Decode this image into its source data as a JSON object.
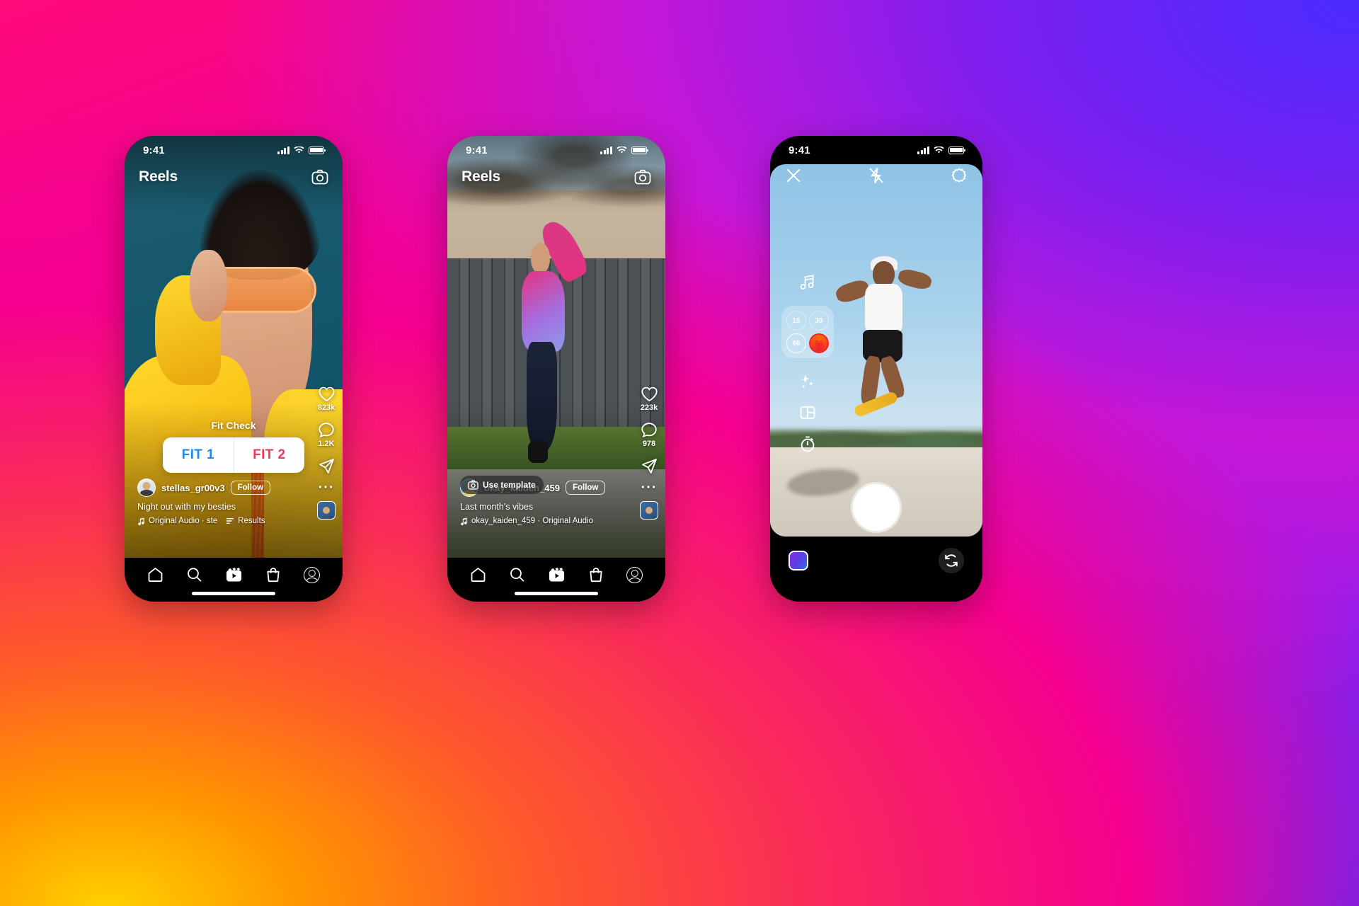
{
  "background": {
    "gradient_colors": [
      "#ff0a7a",
      "#f5008f",
      "#c814cf",
      "#8a1ef0",
      "#5b2bff",
      "#ff9500",
      "#ffd000"
    ]
  },
  "phones": [
    {
      "id": "reels-poll",
      "status_bar": {
        "time": "9:41",
        "signal_icon": "cellular-bars-icon",
        "wifi_icon": "wifi-icon",
        "battery_icon": "battery-icon"
      },
      "header": {
        "title": "Reels",
        "camera_icon": "camera-icon"
      },
      "poll": {
        "question": "Fit Check",
        "option_1": "FIT 1",
        "option_2": "FIT 2",
        "option_1_color": "#1b8ce8",
        "option_2_color": "#ef3b5b"
      },
      "actions": [
        {
          "icon": "heart-icon",
          "count": "823k"
        },
        {
          "icon": "comment-icon",
          "count": "1.2K"
        },
        {
          "icon": "share-icon",
          "count": ""
        },
        {
          "icon": "more-options-icon",
          "count": ""
        },
        {
          "icon": "audio-thumbnail-icon",
          "count": ""
        }
      ],
      "meta": {
        "username": "stellas_gr00v3",
        "follow_label": "Follow",
        "caption": "Night out with my besties",
        "audio_icon": "music-note-icon",
        "audio_label": "Original Audio · ste",
        "results_icon": "results-list-icon",
        "results_label": "Results"
      },
      "nav": [
        {
          "icon": "home-icon",
          "name": "nav-home"
        },
        {
          "icon": "search-icon",
          "name": "nav-search"
        },
        {
          "icon": "reels-icon",
          "name": "nav-reels"
        },
        {
          "icon": "shop-bag-icon",
          "name": "nav-shop"
        },
        {
          "icon": "profile-icon",
          "name": "nav-profile"
        }
      ]
    },
    {
      "id": "reels-template",
      "status_bar": {
        "time": "9:41",
        "signal_icon": "cellular-bars-icon",
        "wifi_icon": "wifi-icon",
        "battery_icon": "battery-icon"
      },
      "header": {
        "title": "Reels",
        "camera_icon": "camera-icon"
      },
      "template_chip": {
        "icon": "camera-icon",
        "label": "Use template"
      },
      "actions": [
        {
          "icon": "heart-icon",
          "count": "223k"
        },
        {
          "icon": "comment-icon",
          "count": "978"
        },
        {
          "icon": "share-icon",
          "count": ""
        },
        {
          "icon": "more-options-icon",
          "count": ""
        },
        {
          "icon": "audio-thumbnail-icon",
          "count": ""
        }
      ],
      "meta": {
        "username": "okay_kaiden_459",
        "follow_label": "Follow",
        "caption": "Last month's vibes",
        "audio_icon": "music-note-icon",
        "audio_label": "okay_kaiden_459 · Original Audio"
      },
      "nav": [
        {
          "icon": "home-icon",
          "name": "nav-home"
        },
        {
          "icon": "search-icon",
          "name": "nav-search"
        },
        {
          "icon": "reels-icon",
          "name": "nav-reels"
        },
        {
          "icon": "shop-bag-icon",
          "name": "nav-shop"
        },
        {
          "icon": "profile-icon",
          "name": "nav-profile"
        }
      ]
    },
    {
      "id": "reels-camera",
      "status_bar": {
        "time": "9:41",
        "signal_icon": "cellular-bars-icon",
        "wifi_icon": "wifi-icon",
        "battery_icon": "battery-icon"
      },
      "top_bar": {
        "close_icon": "close-icon",
        "flash_icon": "flash-off-icon",
        "settings_icon": "settings-gear-icon"
      },
      "tools": [
        {
          "icon": "music-note-icon",
          "name": "add-audio-tool"
        },
        {
          "icon": "effects-sparkle-icon",
          "name": "effects-tool"
        },
        {
          "icon": "layout-grid-icon",
          "name": "layout-tool"
        },
        {
          "icon": "timer-icon",
          "name": "timer-tool"
        }
      ],
      "durations": [
        {
          "value": "15",
          "selected": false
        },
        {
          "value": "30",
          "selected": false
        },
        {
          "value": "60",
          "selected": false
        },
        {
          "value": "90",
          "selected": true
        }
      ],
      "selected_duration_color": "#f0232f",
      "bottom": {
        "gallery_icon": "gallery-thumbnail-icon",
        "shutter_icon": "shutter-button",
        "flip_icon": "flip-camera-icon"
      }
    }
  ]
}
